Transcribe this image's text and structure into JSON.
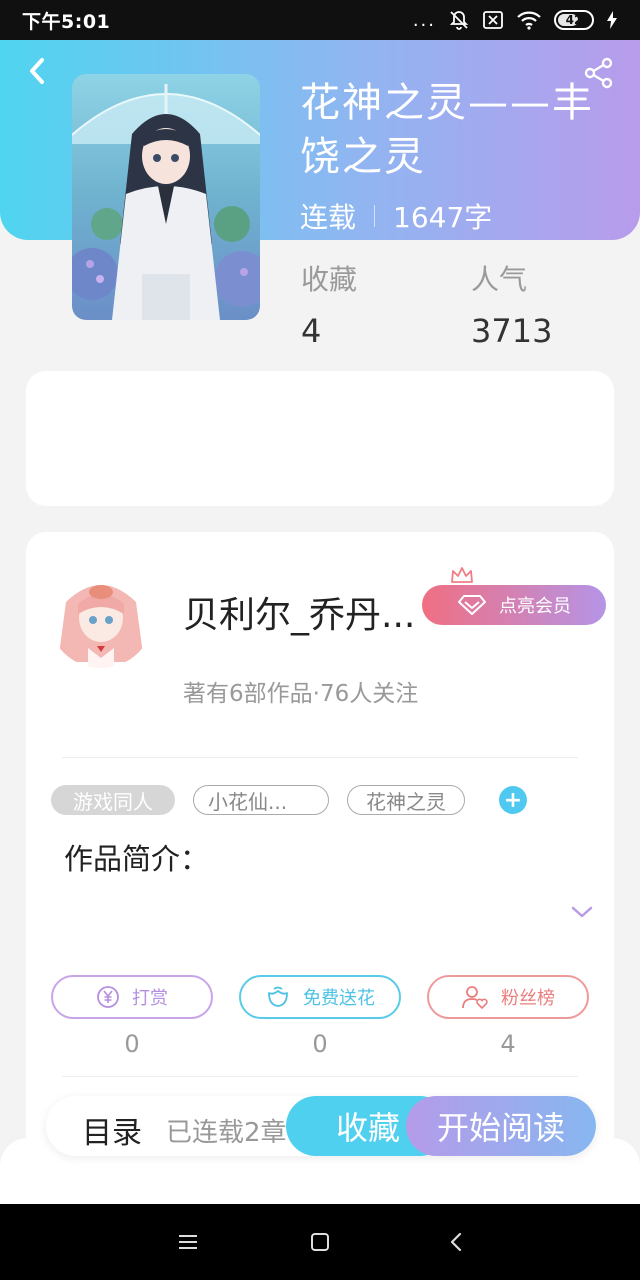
{
  "status": {
    "time": "下午5:01",
    "dots": "...",
    "battery": "42"
  },
  "book": {
    "title": "花神之灵——丰饶之灵",
    "status": "连载",
    "words": "1647字",
    "favorites_label": "收藏",
    "favorites": "4",
    "popularity_label": "人气",
    "popularity": "3713"
  },
  "author": {
    "name": "贝利尔_乔丹...",
    "subtitle": "著有6部作品·76人关注",
    "vip_label": "点亮会员"
  },
  "tags": [
    "游戏同人",
    "小花仙...",
    "花神之灵"
  ],
  "tag_add": "+",
  "intro_label": "作品简介：",
  "actions": [
    {
      "label": "打赏",
      "icon": "yen-icon",
      "count": "0"
    },
    {
      "label": "免费送花",
      "icon": "flower-icon",
      "count": "0"
    },
    {
      "label": "粉丝榜",
      "icon": "fan-heart-icon",
      "count": "4"
    }
  ],
  "bottom": {
    "toc_label": "目录",
    "toc_count": "已连载2章",
    "favorite_button": "收藏",
    "read_button": "开始阅读"
  },
  "colors": {
    "header_start": "#4fd5f0",
    "header_end": "#b89cec",
    "accent_blue": "#4fd0ef",
    "accent_purple": "#b59be9",
    "vip_pink": "#f06f82"
  }
}
